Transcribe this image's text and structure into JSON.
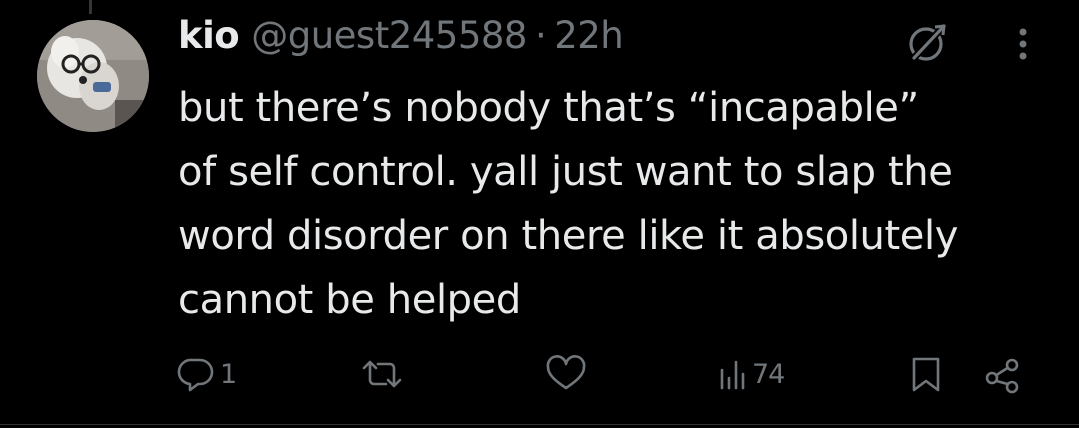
{
  "tweet": {
    "display_name": "kio",
    "handle": "@guest245588",
    "separator": "·",
    "time": "22h",
    "text": "but there’s nobody that’s “incapable”\nof self control. yall just want to slap the\nword disorder on there like it absolutely\ncannot be helped"
  },
  "actions": {
    "reply_count": "1",
    "views_count": "74"
  },
  "icons": {
    "grok": "grok-icon",
    "more": "more-icon",
    "reply": "reply-icon",
    "repost": "repost-icon",
    "like": "heart-icon",
    "views": "views-icon",
    "bookmark": "bookmark-icon",
    "share": "share-icon"
  },
  "colors": {
    "background": "#000000",
    "primary_text": "#e7e9ea",
    "secondary_text": "#71767b"
  }
}
